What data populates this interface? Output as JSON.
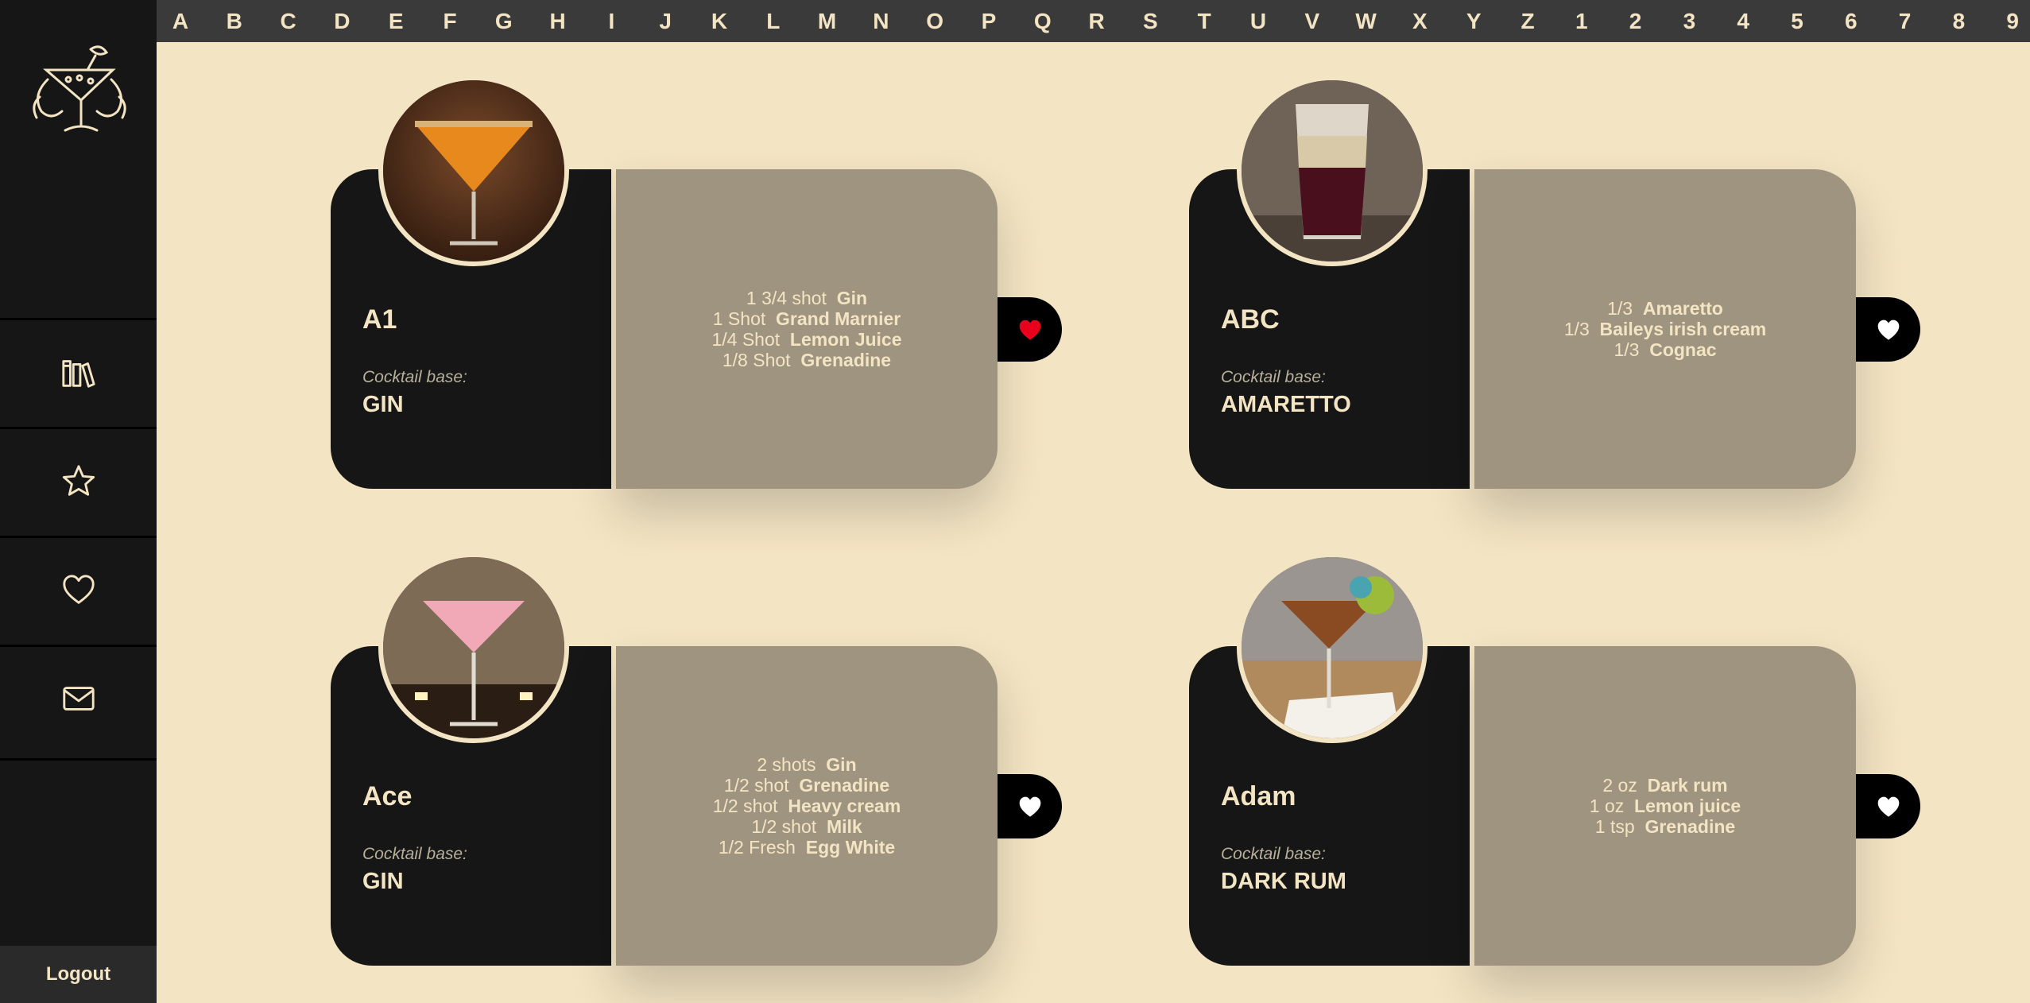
{
  "app": {
    "logout_label": "Logout"
  },
  "alphabet": [
    "A",
    "B",
    "C",
    "D",
    "E",
    "F",
    "G",
    "H",
    "I",
    "J",
    "K",
    "L",
    "M",
    "N",
    "O",
    "P",
    "Q",
    "R",
    "S",
    "T",
    "U",
    "V",
    "W",
    "X",
    "Y",
    "Z",
    "1",
    "2",
    "3",
    "4",
    "5",
    "6",
    "7",
    "8",
    "9"
  ],
  "cocktails": [
    {
      "name": "A1",
      "base_label": "Cocktail base:",
      "base": "GIN",
      "favorited": true,
      "ingredients": [
        {
          "amount": "1 3/4 shot",
          "item": "Gin"
        },
        {
          "amount": "1 Shot",
          "item": "Grand Marnier"
        },
        {
          "amount": "1/4 Shot",
          "item": "Lemon Juice"
        },
        {
          "amount": "1/8 Shot",
          "item": "Grenadine"
        }
      ]
    },
    {
      "name": "ABC",
      "base_label": "Cocktail base:",
      "base": "AMARETTO",
      "favorited": false,
      "ingredients": [
        {
          "amount": "1/3",
          "item": "Amaretto"
        },
        {
          "amount": "1/3",
          "item": "Baileys irish cream"
        },
        {
          "amount": "1/3",
          "item": "Cognac"
        }
      ]
    },
    {
      "name": "Ace",
      "base_label": "Cocktail base:",
      "base": "GIN",
      "favorited": false,
      "ingredients": [
        {
          "amount": "2 shots",
          "item": "Gin"
        },
        {
          "amount": "1/2 shot",
          "item": "Grenadine"
        },
        {
          "amount": "1/2 shot",
          "item": "Heavy cream"
        },
        {
          "amount": "1/2 shot",
          "item": "Milk"
        },
        {
          "amount": "1/2 Fresh",
          "item": "Egg White"
        }
      ]
    },
    {
      "name": "Adam",
      "base_label": "Cocktail base:",
      "base": "DARK RUM",
      "favorited": false,
      "ingredients": [
        {
          "amount": "2 oz",
          "item": "Dark rum"
        },
        {
          "amount": "1 oz",
          "item": "Lemon juice"
        },
        {
          "amount": "1 tsp",
          "item": "Grenadine"
        }
      ]
    }
  ],
  "colors": {
    "favorite_active": "#e8001c",
    "favorite_inactive": "#ffffff"
  },
  "icons": [
    "cocktail-logo-icon",
    "library-icon",
    "star-icon",
    "heart-icon",
    "mail-icon"
  ]
}
